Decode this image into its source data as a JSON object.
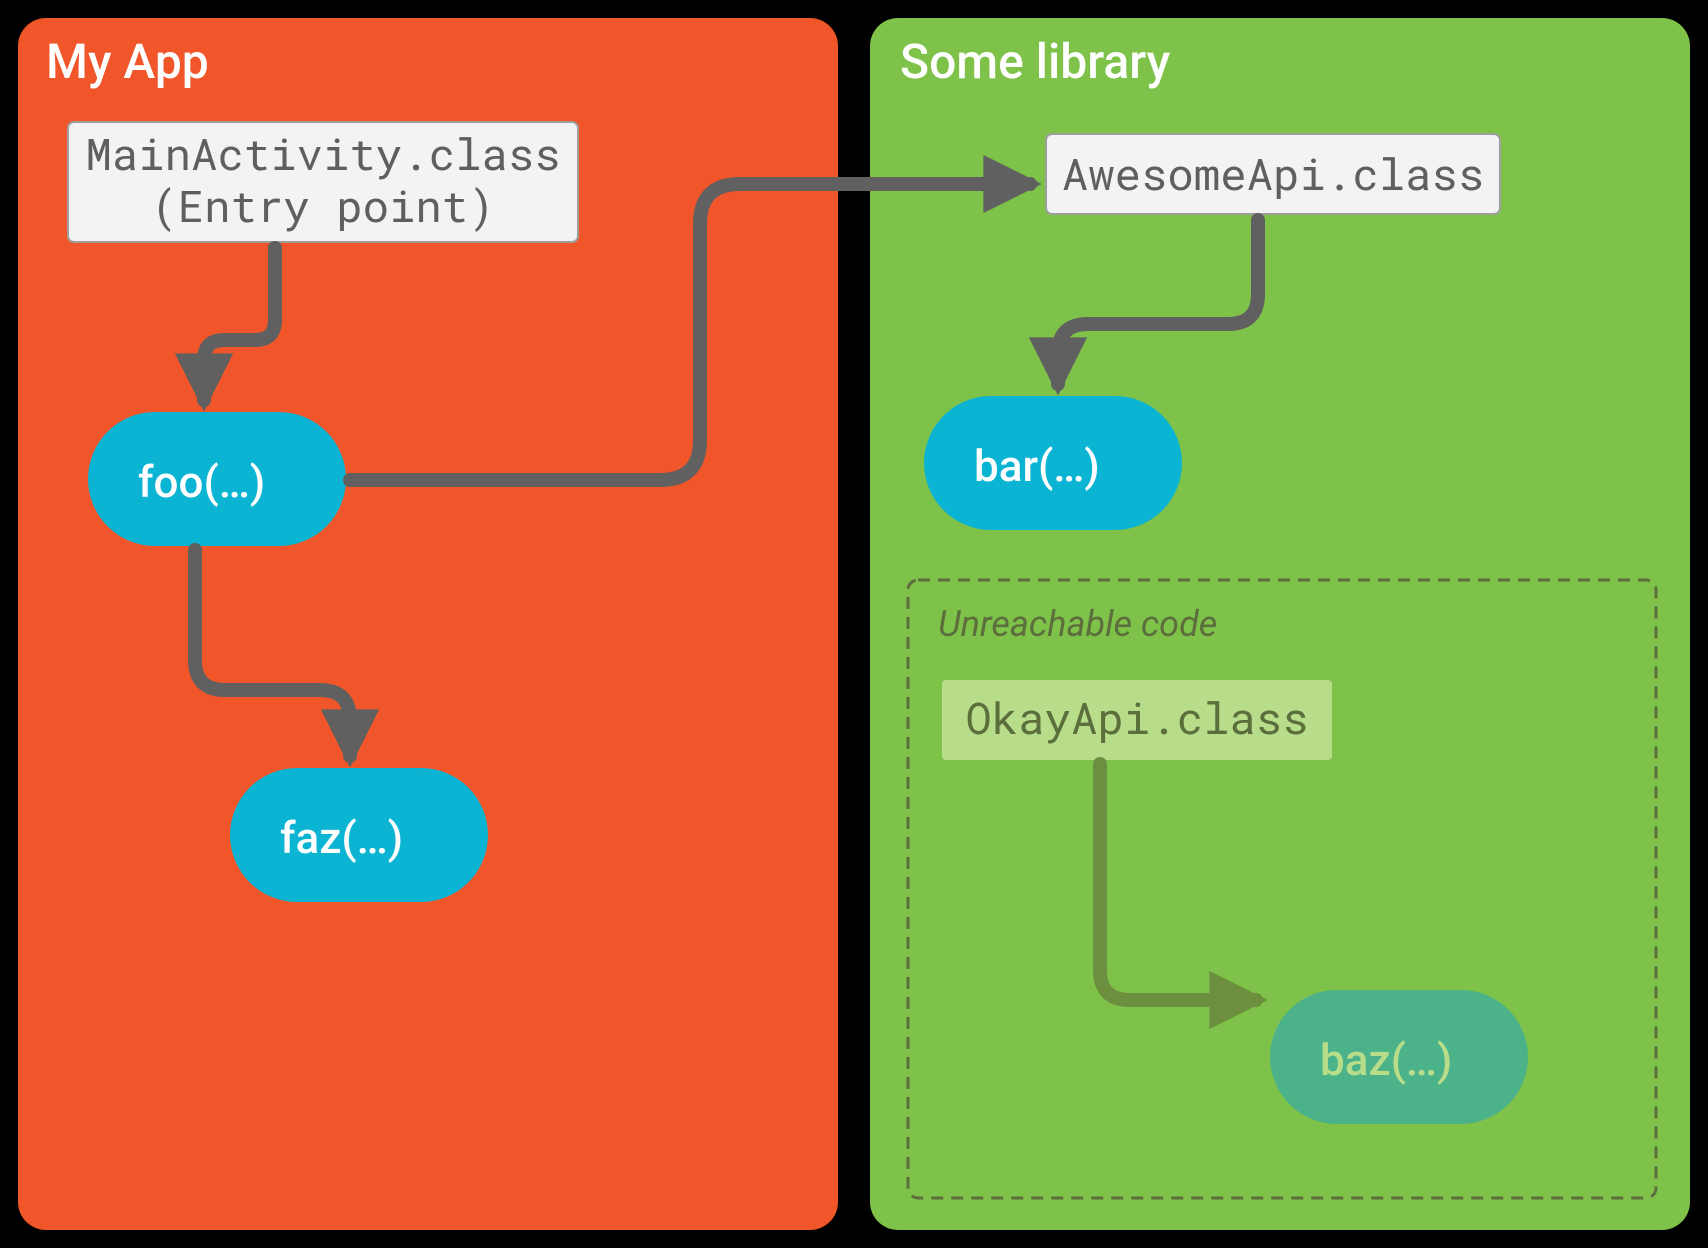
{
  "left": {
    "title": "My App",
    "entry": {
      "line1": "MainActivity.class",
      "line2": "(Entry point)"
    },
    "methods": {
      "foo": "foo(…)",
      "faz": "faz(…)"
    }
  },
  "right": {
    "title": "Some library",
    "api": "AwesomeApi.class",
    "methods": {
      "bar": "bar(…)"
    },
    "unreachable": {
      "title": "Unreachable code",
      "api": "OkayApi.class",
      "methods": {
        "baz": "baz(…)"
      }
    }
  },
  "colors": {
    "leftPanel": "#f0562a",
    "rightPanel": "#7fc24a",
    "pill": "#0bb4d3",
    "edge": "#606060",
    "edgeFaded": "#6b8f3e"
  }
}
